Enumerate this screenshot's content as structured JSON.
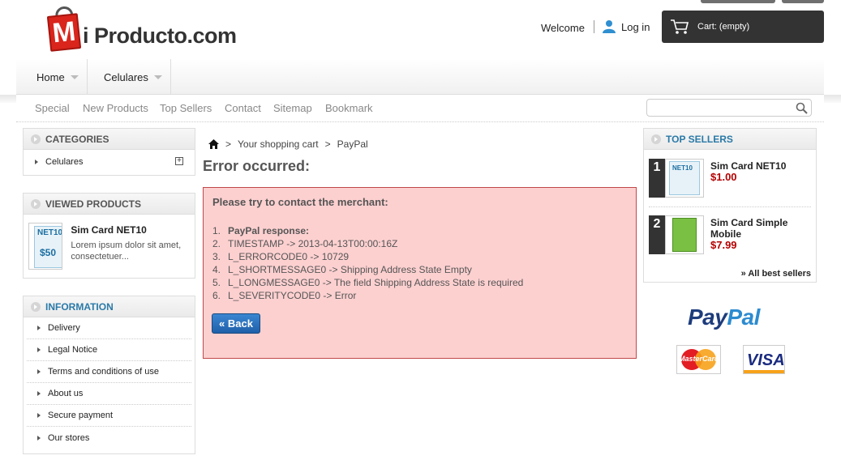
{
  "header": {
    "logo": {
      "initial": "M",
      "text": "i Producto.com"
    },
    "welcome": "Welcome",
    "login": "Log in",
    "cart": "Cart: (empty)"
  },
  "nav": {
    "items": [
      {
        "label": "Home"
      },
      {
        "label": "Celulares"
      }
    ]
  },
  "sublinks": [
    "Special",
    "New Products",
    "Top Sellers",
    "Contact",
    "Sitemap",
    "Bookmark"
  ],
  "search": {
    "placeholder": ""
  },
  "categories": {
    "title": "Categories",
    "items": [
      {
        "label": "Celulares"
      }
    ]
  },
  "viewed": {
    "title": "Viewed products",
    "product": {
      "name": "Sim Card NET10",
      "description": "Lorem ipsum dolor sit amet, consectetuer...",
      "thumb_logo": "NET10",
      "thumb_value": "$50"
    }
  },
  "information": {
    "title": "Information",
    "items": [
      "Delivery",
      "Legal Notice",
      "Terms and conditions of use",
      "About us",
      "Secure payment",
      "Our stores"
    ]
  },
  "breadcrumb": {
    "separator": ">",
    "items": [
      "Your shopping cart",
      "PayPal"
    ]
  },
  "page_title": "Error occurred:",
  "error": {
    "heading": "Please try to contact the merchant:",
    "lines": [
      {
        "n": "1.",
        "text": "PayPal response:",
        "bold": true
      },
      {
        "n": "2.",
        "text": "TIMESTAMP -> 2013-04-13T00:00:16Z"
      },
      {
        "n": "3.",
        "text": "L_ERRORCODE0 -> 10729"
      },
      {
        "n": "4.",
        "text": "L_SHORTMESSAGE0 -> Shipping Address State Empty"
      },
      {
        "n": "5.",
        "text": "L_LONGMESSAGE0 -> The field Shipping Address State is required"
      },
      {
        "n": "6.",
        "text": "L_SEVERITYCODE0 -> Error"
      }
    ],
    "back_label": "« Back"
  },
  "top_sellers": {
    "title": "Top sellers",
    "items": [
      {
        "rank": "1",
        "name": "Sim Card NET10",
        "price": "$1.00"
      },
      {
        "rank": "2",
        "name": "Sim Card Simple Mobile",
        "price": "$7.99"
      }
    ],
    "all_label": "» All best sellers"
  },
  "paypal": {
    "brand_a": "Pay",
    "brand_b": "Pal",
    "mastercard": "MasterCard",
    "visa": "VISA"
  },
  "colors": {
    "accent_blue": "#2a7aa8",
    "error_bg": "#fdd0d0",
    "error_border": "#c04848",
    "price_red": "#b50000",
    "cart_bg": "#333333"
  }
}
